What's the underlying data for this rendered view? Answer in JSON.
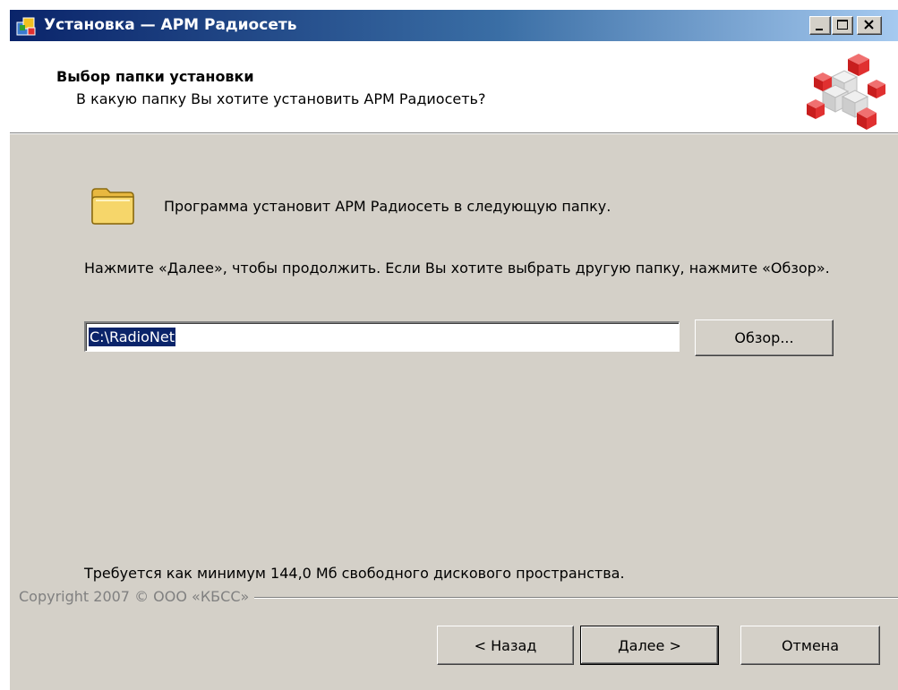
{
  "window": {
    "title": "Установка — АРМ Радиосеть",
    "icons": {
      "app": "installer-icon",
      "minimize": "minimize-icon",
      "maximize": "maximize-icon",
      "close": "close-icon"
    }
  },
  "header": {
    "title": "Выбор папки установки",
    "subtitle": "В какую папку Вы хотите установить АРМ Радиосеть?",
    "image_icon": "installer-cubes-image"
  },
  "body": {
    "folder_icon": "folder-icon",
    "info_text": "Программа установит АРМ Радиосеть в следующую папку.",
    "instruction_text": "Нажмите «Далее», чтобы продолжить. Если Вы хотите выбрать другую папку, нажмите «Обзор».",
    "path_value": "C:\\RadioNet",
    "browse_label": "Обзор...",
    "disk_space_text": "Требуется как минимум 144,0 Мб свободного дискового пространства."
  },
  "footer": {
    "copyright": "Copyright 2007 © ООО «КБСС»",
    "back_label": "< Назад",
    "next_label": "Далее >",
    "cancel_label": "Отмена"
  },
  "colors": {
    "window_bg": "#d4d0c8",
    "titlebar_start": "#0a246a",
    "titlebar_end": "#a6caf0",
    "selection": "#0a246a",
    "cube_red": "#e03030"
  }
}
